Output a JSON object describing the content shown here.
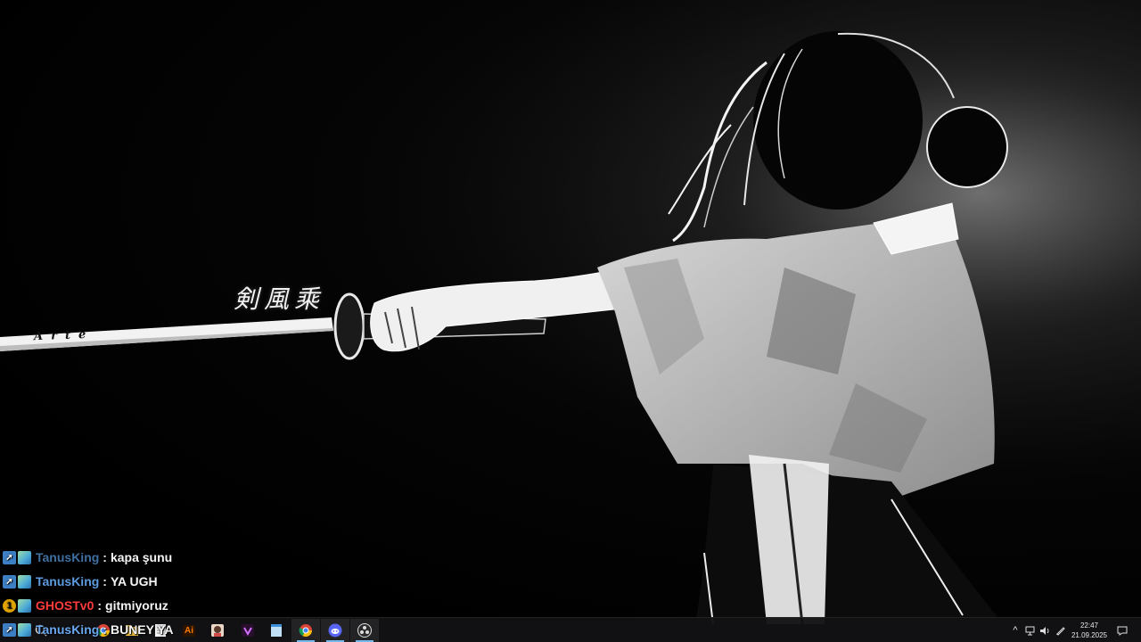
{
  "wallpaper": {
    "calligraphy_text": "剣風乘",
    "blade_inscription": "Arte"
  },
  "chat": {
    "messages": [
      {
        "badges": [
          "arrow-badge",
          "game-badge"
        ],
        "username": "TanusKing",
        "user_color": "#3f6fa0",
        "separator": ":",
        "message": "kapa şunu"
      },
      {
        "badges": [
          "arrow-badge",
          "game-badge"
        ],
        "username": "TanusKing",
        "user_color": "#5b9be0",
        "separator": ":",
        "message": "YA UGH"
      },
      {
        "badges": [
          "level-badge",
          "game-badge"
        ],
        "username": "GHOSTv0",
        "user_color": "#ff3b3b",
        "level": "1",
        "separator": ":",
        "message": "gitmiyoruz"
      },
      {
        "badges": [
          "arrow-badge",
          "game-badge"
        ],
        "username": "TanusKing",
        "user_color": "#6aa8f0",
        "separator": ":",
        "message": "BUNEY YA"
      }
    ]
  },
  "taskbar": {
    "apps": [
      {
        "name": "search-icon",
        "label": ""
      },
      {
        "name": "chrome-icon",
        "label": ""
      },
      {
        "name": "file-explorer-icon",
        "label": ""
      },
      {
        "name": "notes-icon",
        "label": ""
      },
      {
        "name": "illustrator-icon",
        "label": "Ai"
      },
      {
        "name": "anime-app-icon",
        "label": ""
      },
      {
        "name": "vegas-icon",
        "label": ""
      },
      {
        "name": "notepad-icon",
        "label": ""
      },
      {
        "name": "chrome-icon",
        "label": ""
      },
      {
        "name": "discord-icon",
        "label": ""
      },
      {
        "name": "obs-icon",
        "label": ""
      }
    ],
    "tray": {
      "chevron": "^",
      "clock_time": "22:47",
      "clock_date": "21.09.2025"
    }
  },
  "colors": {
    "taskbar_bg": "#121214",
    "accent": "#76b9ed"
  }
}
